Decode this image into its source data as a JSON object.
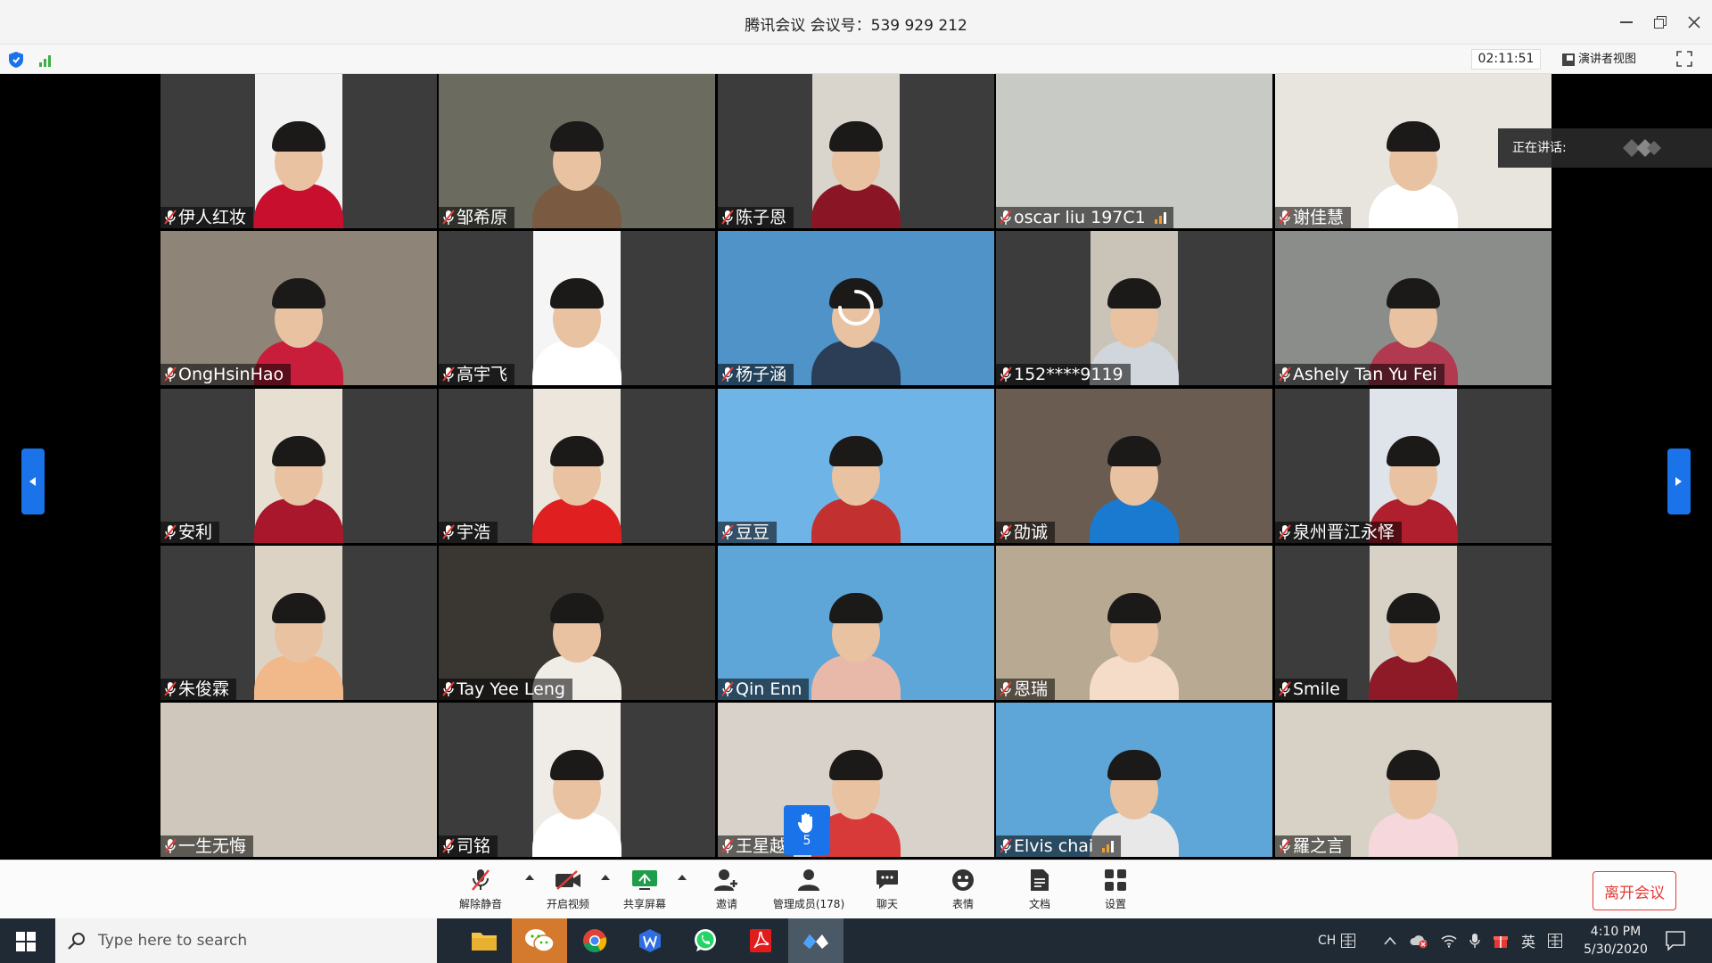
{
  "window": {
    "title": "腾讯会议 会议号：539 929 212"
  },
  "infobar": {
    "timer": "02:11:51",
    "presenter_view_label": "演讲者视图"
  },
  "speaking": {
    "label": "正在讲话:"
  },
  "tiles": [
    {
      "name": "伊人红妆"
    },
    {
      "name": "邹希原"
    },
    {
      "name": "陈子恩"
    },
    {
      "name": "oscar liu 197C1"
    },
    {
      "name": "谢佳慧"
    },
    {
      "name": "OngHsinHao"
    },
    {
      "name": "高宇飞"
    },
    {
      "name": "杨子涵"
    },
    {
      "name": "152****9119"
    },
    {
      "name": "Ashely Tan Yu Fei"
    },
    {
      "name": "安利"
    },
    {
      "name": "宇浩"
    },
    {
      "name": "豆豆"
    },
    {
      "name": "劭诚"
    },
    {
      "name": "泉州晋江永怿"
    },
    {
      "name": "朱俊霖"
    },
    {
      "name": "Tay Yee Leng"
    },
    {
      "name": "Qin Enn"
    },
    {
      "name": "恩瑞"
    },
    {
      "name": "Smile"
    },
    {
      "name": "一生无悔"
    },
    {
      "name": "司铭"
    },
    {
      "name": "王星越"
    },
    {
      "name": "Elvis chai"
    },
    {
      "name": "羅之言"
    }
  ],
  "hand_raise": {
    "count": "5"
  },
  "toolbar": {
    "unmute": "解除静音",
    "start_video": "开启视频",
    "share_screen": "共享屏幕",
    "invite": "邀请",
    "manage_members": "管理成员(178)",
    "chat": "聊天",
    "emoji": "表情",
    "docs": "文档",
    "settings": "设置",
    "leave": "离开会议"
  },
  "taskbar": {
    "search_placeholder": "Type here to search",
    "lang_ch": "CH",
    "ime": "英",
    "time": "4:10 PM",
    "date": "5/30/2020"
  },
  "colors": {
    "accent": "#1a73e8",
    "leave": "#e53935",
    "signal_orange": "#f0a030",
    "signal_green": "#3cb043"
  }
}
